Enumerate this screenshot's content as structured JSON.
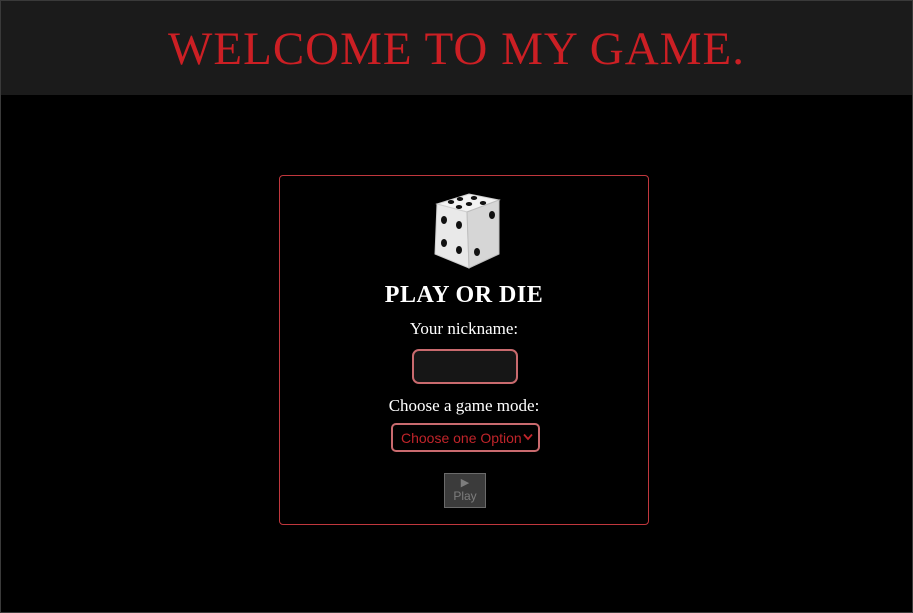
{
  "header": {
    "title": "WELCOME TO MY GAME."
  },
  "card": {
    "title": "PLAY OR DIE",
    "nickname_label": "Your nickname:",
    "nickname_value": "",
    "mode_label": "Choose a game mode:",
    "mode_selected": "Choose one Option",
    "play_icon": "▶",
    "play_label": "Play"
  },
  "icons": {
    "dice": "dice-icon",
    "chevron": "chevron-down-icon",
    "play": "play-icon"
  },
  "colors": {
    "accent_red": "#cc1f24",
    "border_red": "#c0373d",
    "header_bg": "#1b1b1b",
    "page_bg": "#000000"
  }
}
